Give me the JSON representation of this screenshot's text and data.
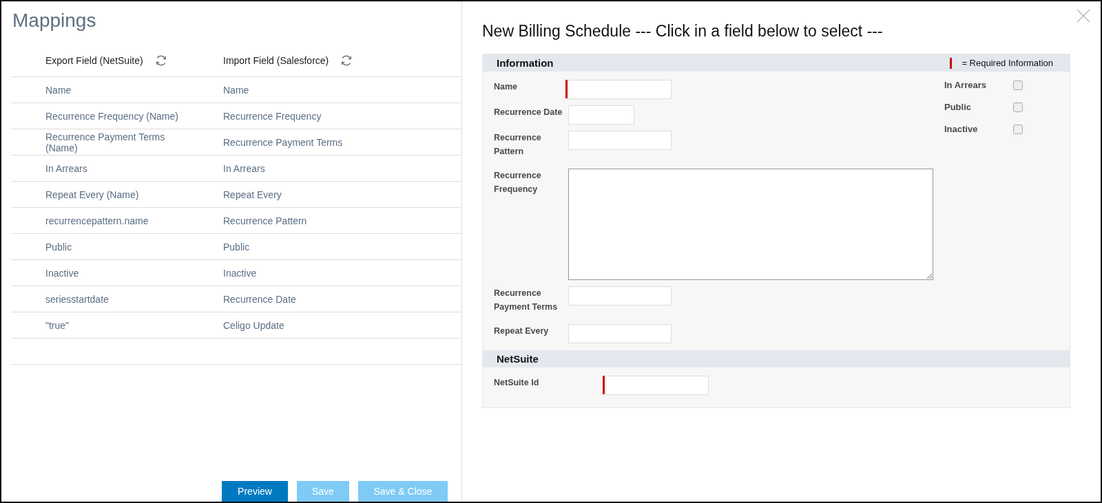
{
  "mappings": {
    "title": "Mappings",
    "columns": [
      {
        "label": "Export Field (NetSuite)"
      },
      {
        "label": "Import Field (Salesforce)"
      }
    ],
    "rows": [
      {
        "export": "Name",
        "import": "Name"
      },
      {
        "export": "Recurrence Frequency (Name)",
        "import": "Recurrence Frequency"
      },
      {
        "export": "Recurrence Payment Terms (Name)",
        "import": "Recurrence Payment Terms"
      },
      {
        "export": "In Arrears",
        "import": "In Arrears"
      },
      {
        "export": "Repeat Every (Name)",
        "import": "Repeat Every"
      },
      {
        "export": "recurrencepattern.name",
        "import": "Recurrence Pattern"
      },
      {
        "export": "Public",
        "import": "Public"
      },
      {
        "export": "Inactive",
        "import": "Inactive"
      },
      {
        "export": "seriesstartdate",
        "import": "Recurrence Date"
      },
      {
        "export": "\"true\"",
        "import": "Celigo Update"
      }
    ],
    "buttons": [
      {
        "label": "Preview",
        "disabled": false
      },
      {
        "label": "Save",
        "disabled": true
      },
      {
        "label": "Save & Close",
        "disabled": true
      }
    ]
  },
  "form": {
    "title": "New Billing Schedule --- Click in a field below to select ---",
    "legend": "= Required Information",
    "sections": [
      {
        "title": "Information",
        "fields": [
          {
            "label": "Name",
            "kind": "text",
            "required": true
          },
          {
            "label": "Recurrence Date",
            "kind": "date",
            "required": false
          },
          {
            "label": "Recurrence Pattern",
            "kind": "text",
            "required": false
          },
          {
            "label": "Recurrence Frequency",
            "kind": "textarea",
            "required": false
          },
          {
            "label": "Recurrence Payment Terms",
            "kind": "text",
            "required": false
          },
          {
            "label": "Repeat Every",
            "kind": "text",
            "required": false
          }
        ],
        "checkboxes": [
          {
            "label": "In Arrears",
            "checked": false
          },
          {
            "label": "Public",
            "checked": false
          },
          {
            "label": "Inactive",
            "checked": false
          }
        ]
      },
      {
        "title": "NetSuite",
        "fields": [
          {
            "label": "NetSuite Id",
            "kind": "text",
            "required": true
          }
        ]
      }
    ]
  }
}
